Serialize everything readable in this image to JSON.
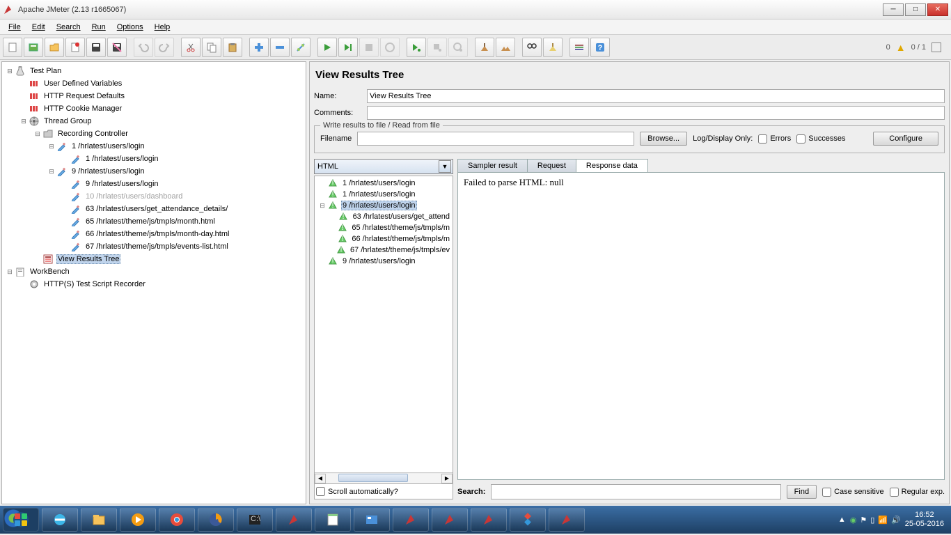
{
  "titlebar": {
    "text": "Apache JMeter (2.13 r1665067)"
  },
  "menubar": [
    "File",
    "Edit",
    "Search",
    "Run",
    "Options",
    "Help"
  ],
  "status": {
    "warnings": "0",
    "left": "0",
    "right": "1"
  },
  "tree": [
    {
      "depth": 0,
      "toggle": "−",
      "icon": "flask",
      "label": "Test Plan"
    },
    {
      "depth": 1,
      "toggle": "",
      "icon": "vars",
      "label": "User Defined Variables"
    },
    {
      "depth": 1,
      "toggle": "",
      "icon": "vars",
      "label": "HTTP Request Defaults"
    },
    {
      "depth": 1,
      "toggle": "",
      "icon": "vars",
      "label": "HTTP Cookie Manager"
    },
    {
      "depth": 1,
      "toggle": "−",
      "icon": "thread",
      "label": "Thread Group"
    },
    {
      "depth": 2,
      "toggle": "−",
      "icon": "folder",
      "label": "Recording Controller"
    },
    {
      "depth": 3,
      "toggle": "−",
      "icon": "pen",
      "label": "1 /hrlatest/users/login"
    },
    {
      "depth": 4,
      "toggle": "",
      "icon": "pen",
      "label": "1 /hrlatest/users/login"
    },
    {
      "depth": 3,
      "toggle": "−",
      "icon": "pen",
      "label": "9 /hrlatest/users/login"
    },
    {
      "depth": 4,
      "toggle": "",
      "icon": "pen",
      "label": "9 /hrlatest/users/login"
    },
    {
      "depth": 4,
      "toggle": "",
      "icon": "pen",
      "label": "10 /hrlatest/users/dashboard",
      "disabled": true
    },
    {
      "depth": 4,
      "toggle": "",
      "icon": "pen",
      "label": "63 /hrlatest/users/get_attendance_details/"
    },
    {
      "depth": 4,
      "toggle": "",
      "icon": "pen",
      "label": "65 /hrlatest/theme/js/tmpls/month.html"
    },
    {
      "depth": 4,
      "toggle": "",
      "icon": "pen",
      "label": "66 /hrlatest/theme/js/tmpls/month-day.html"
    },
    {
      "depth": 4,
      "toggle": "",
      "icon": "pen",
      "label": "67 /hrlatest/theme/js/tmpls/events-list.html"
    },
    {
      "depth": 2,
      "toggle": "",
      "icon": "view",
      "label": "View Results Tree",
      "selected": true
    },
    {
      "depth": 0,
      "toggle": "−",
      "icon": "work",
      "label": "WorkBench"
    },
    {
      "depth": 1,
      "toggle": "",
      "icon": "gear",
      "label": "HTTP(S) Test Script Recorder"
    }
  ],
  "panel": {
    "title": "View Results Tree",
    "name_label": "Name:",
    "name_value": "View Results Tree",
    "comments_label": "Comments:",
    "fieldset_legend": "Write results to file / Read from file",
    "filename_label": "Filename",
    "browse": "Browse...",
    "log_display": "Log/Display Only:",
    "errors": "Errors",
    "successes": "Successes",
    "configure": "Configure",
    "combo_value": "HTML",
    "scroll_auto": "Scroll automatically?",
    "tabs": [
      "Sampler result",
      "Request",
      "Response data"
    ],
    "active_tab": 2,
    "detail_text": "Failed to parse HTML: null",
    "search_label": "Search:",
    "find": "Find",
    "case_sensitive": "Case sensitive",
    "regex": "Regular exp."
  },
  "results": [
    {
      "toggle": "",
      "label": "1 /hrlatest/users/login"
    },
    {
      "toggle": "",
      "label": "1 /hrlatest/users/login"
    },
    {
      "toggle": "−",
      "label": "9 /hrlatest/users/login",
      "selected": true
    },
    {
      "toggle": "",
      "label": "63 /hrlatest/users/get_attend",
      "indent": 1
    },
    {
      "toggle": "",
      "label": "65 /hrlatest/theme/js/tmpls/m",
      "indent": 1
    },
    {
      "toggle": "",
      "label": "66 /hrlatest/theme/js/tmpls/m",
      "indent": 1
    },
    {
      "toggle": "",
      "label": "67 /hrlatest/theme/js/tmpls/ev",
      "indent": 1
    },
    {
      "toggle": "",
      "label": "9 /hrlatest/users/login"
    }
  ],
  "taskbar": {
    "time": "16:52",
    "date": "25-05-2016"
  }
}
